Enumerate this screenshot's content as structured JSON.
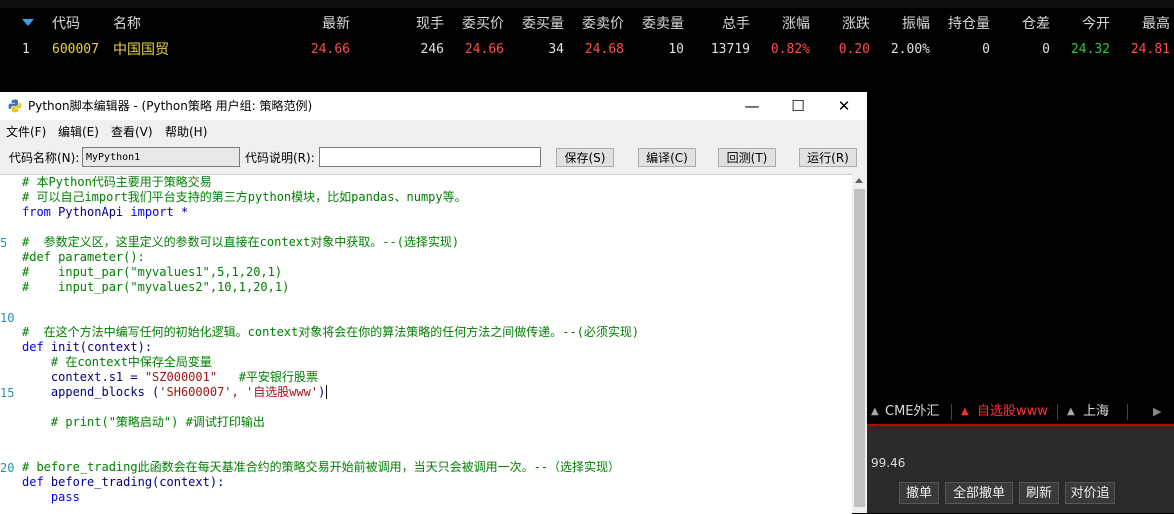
{
  "board": {
    "headers": [
      "代码",
      "名称",
      "最新",
      "现手",
      "委买价",
      "委买量",
      "委卖价",
      "委卖量",
      "总手",
      "涨幅",
      "涨跌",
      "振幅",
      "持仓量",
      "仓差",
      "今开",
      "最高"
    ],
    "row": {
      "index": "1",
      "code": "600007",
      "name": "中国国贸",
      "last": "24.66",
      "cur_vol": "246",
      "bid": "24.66",
      "bid_vol": "34",
      "ask": "24.68",
      "ask_vol": "10",
      "total_vol": "13719",
      "pct_change": "0.82%",
      "change": "0.20",
      "amplitude": "2.00%",
      "open_interest": "0",
      "oi_change": "0",
      "open": "24.32",
      "high": "24.81"
    },
    "colors": {
      "header_text": "#d8d8d8",
      "up": "#ff4d4d",
      "neutral": "#e0e0e0",
      "down": "#22cc44",
      "code": "#e6d24a"
    }
  },
  "editor": {
    "title": "Python脚本编辑器 - (Python策略 用户组: 策略范例)",
    "menu": [
      "文件(F)",
      "编辑(E)",
      "查看(V)",
      "帮助(H)"
    ],
    "toolbar": {
      "code_name_label": "代码名称(N):",
      "code_name_value": "MyPython1",
      "code_desc_label": "代码说明(R):",
      "code_desc_value": "",
      "save": "保存(S)",
      "compile": "编译(C)",
      "test": "回测(T)",
      "run": "运行(R)"
    },
    "line_numbers": [
      "5",
      "10",
      "15",
      "20"
    ],
    "code_lines": [
      {
        "t": "# 本Python代码主要用于策略交易",
        "c": "cm"
      },
      {
        "t": "# 可以自己import我们平台支持的第三方python模块，比如pandas、numpy等。",
        "c": "cm"
      },
      {
        "t": "from PythonApi import *",
        "c": "mix1"
      },
      {
        "t": "",
        "c": "cm"
      },
      {
        "t": "#  参数定义区，这里定义的参数可以直接在context对象中获取。--(选择实现)",
        "c": "cm"
      },
      {
        "t": "#def parameter():",
        "c": "cm"
      },
      {
        "t": "#    input_par(\"myvalues1\",5,1,20,1)",
        "c": "cm"
      },
      {
        "t": "#    input_par(\"myvalues2\",10,1,20,1)",
        "c": "cm"
      },
      {
        "t": "",
        "c": "cm"
      },
      {
        "t": "",
        "c": "cm"
      },
      {
        "t": "#  在这个方法中编写任何的初始化逻辑。context对象将会在你的算法策略的任何方法之间做传递。--(必须实现)",
        "c": "cm"
      },
      {
        "t": "def init(context):",
        "c": "mix2"
      },
      {
        "t": "    # 在context中保存全局变量",
        "c": "cm"
      },
      {
        "t": "    context.s1 = \"SZ000001\"   #平安银行股票",
        "c": "mix3"
      },
      {
        "t": "    append_blocks ('SH600007', '自选股www')",
        "c": "mix4"
      },
      {
        "t": "",
        "c": "cm"
      },
      {
        "t": "    # print(\"策略启动\") #调试打印输出",
        "c": "cm"
      },
      {
        "t": "",
        "c": "cm"
      },
      {
        "t": "",
        "c": "cm"
      },
      {
        "t": "# before_trading此函数会在每天基准合约的策略交易开始前被调用，当天只会被调用一次。--（选择实现）",
        "c": "cm"
      },
      {
        "t": "def before_trading(context):",
        "c": "mix5"
      },
      {
        "t": "    pass",
        "c": "mix6"
      }
    ]
  },
  "right_panel": {
    "tabs": [
      "CME外汇",
      "自选股www",
      "上海"
    ],
    "value": "99.46",
    "buttons": [
      "撤单",
      "全部撤单",
      "刷新",
      "对价追"
    ]
  }
}
